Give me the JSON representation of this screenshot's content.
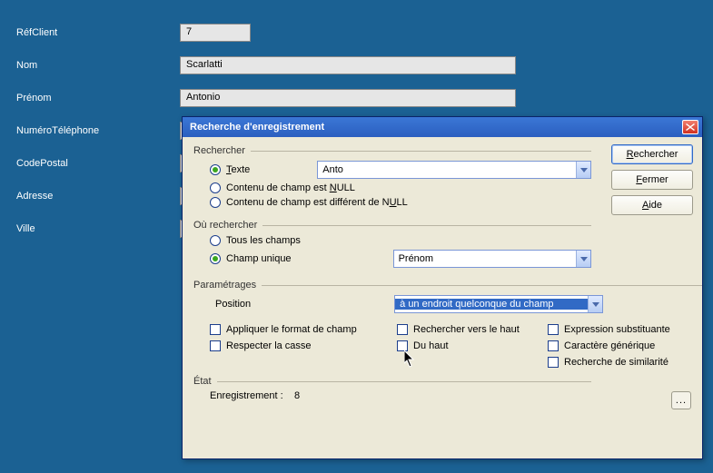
{
  "bgForm": {
    "labels": {
      "refClient": "RéfClient",
      "nom": "Nom",
      "prenom": "Prénom",
      "tel": "NuméroTéléphone",
      "cp": "CodePostal",
      "adresse": "Adresse",
      "ville": "Ville"
    },
    "values": {
      "refClient": "7",
      "nom": "Scarlatti",
      "prenom": "Antonio"
    }
  },
  "dialog": {
    "title": "Recherche d'enregistrement",
    "buttons": {
      "search": "Rechercher",
      "close": "Fermer",
      "help": "Aide",
      "more": "..."
    },
    "rechercher": {
      "legend": "Rechercher",
      "opt_texte": "Texte",
      "opt_null_pre": "Contenu de champ est ",
      "opt_null_u": "N",
      "opt_null_post": "ULL",
      "opt_notnull_pre": "Contenu de champ est différent de N",
      "opt_notnull_u": "U",
      "opt_notnull_post": "LL",
      "search_value": "Anto",
      "selected": "texte"
    },
    "ou": {
      "legend": "Où rechercher",
      "opt_all": "Tous les champs",
      "opt_single": "Champ unique",
      "selected": "single",
      "field_value": "Prénom"
    },
    "params": {
      "legend": "Paramétrages",
      "position_label": "Position",
      "position_value": "à un endroit quelconque du champ",
      "ck_format": "Appliquer le format de champ",
      "ck_case": "Respecter la casse",
      "ck_up": "Rechercher vers le haut",
      "ck_top": "Du haut",
      "ck_substi": "Expression substituante",
      "ck_wildcard": "Caractère générique",
      "ck_similar": "Recherche de similarité"
    },
    "etat": {
      "legend": "État",
      "label": "Enregistrement :",
      "value": "8"
    }
  }
}
